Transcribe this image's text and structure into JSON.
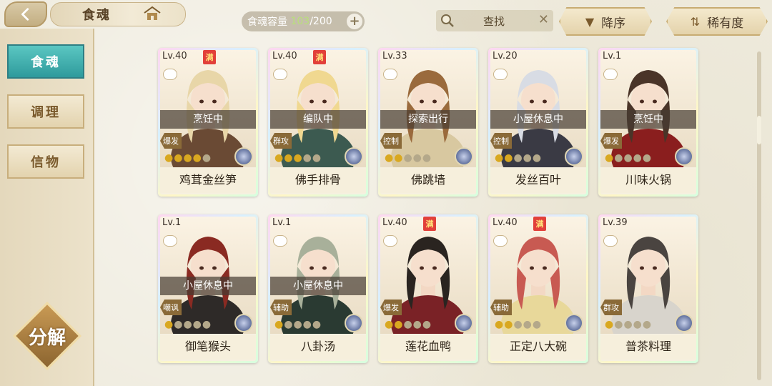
{
  "header": {
    "title": "食魂",
    "capacity_label": "食魂容量",
    "capacity_current": "103",
    "capacity_sep": "/",
    "capacity_max": "200",
    "search_label": "查找",
    "sort_desc": "降序",
    "sort_rarity": "稀有度"
  },
  "sidebar": {
    "tabs": [
      {
        "label": "食魂"
      },
      {
        "label": "调理"
      },
      {
        "label": "信物"
      }
    ],
    "decompose": "分解"
  },
  "cards": [
    {
      "level": "Lv.40",
      "full": "满",
      "status": "烹饪中",
      "role": "爆发",
      "stars_filled": 4,
      "name": "鸡茸金丝笋",
      "hair": "#e8d6a8",
      "outfit": "#6a4a34"
    },
    {
      "level": "Lv.40",
      "full": "满",
      "status": "编队中",
      "role": "群攻",
      "stars_filled": 3,
      "name": "佛手排骨",
      "hair": "#f0d890",
      "outfit": "#3c5a50"
    },
    {
      "level": "Lv.33",
      "full": "",
      "status": "探索出行",
      "role": "控制",
      "stars_filled": 2,
      "name": "佛跳墙",
      "hair": "#9a6a3c",
      "outfit": "#d8c8a0"
    },
    {
      "level": "Lv.20",
      "full": "",
      "status": "小屋休息中",
      "role": "控制",
      "stars_filled": 2,
      "name": "发丝百叶",
      "hair": "#d8dce4",
      "outfit": "#3a3a44"
    },
    {
      "level": "Lv.1",
      "full": "",
      "status": "烹饪中",
      "role": "爆发",
      "stars_filled": 1,
      "name": "川味火锅",
      "hair": "#4a3428",
      "outfit": "#8a1e1e"
    },
    {
      "level": "Lv.1",
      "full": "",
      "status": "小屋休息中",
      "role": "嘲讽",
      "stars_filled": 1,
      "name": "御笔猴头",
      "hair": "#8a2a22",
      "outfit": "#2e2a28"
    },
    {
      "level": "Lv.1",
      "full": "",
      "status": "小屋休息中",
      "role": "辅助",
      "stars_filled": 1,
      "name": "八卦汤",
      "hair": "#a8b09a",
      "outfit": "#2a3a32"
    },
    {
      "level": "Lv.40",
      "full": "满",
      "status": "",
      "role": "爆发",
      "stars_filled": 2,
      "name": "莲花血鸭",
      "hair": "#2a2420",
      "outfit": "#7a2226"
    },
    {
      "level": "Lv.40",
      "full": "满",
      "status": "",
      "role": "辅助",
      "stars_filled": 2,
      "name": "正定八大碗",
      "hair": "#c85a52",
      "outfit": "#e8d89a"
    },
    {
      "level": "Lv.39",
      "full": "",
      "status": "",
      "role": "群攻",
      "stars_filled": 1,
      "name": "普茶料理",
      "hair": "#4a4440",
      "outfit": "#d8d4cc"
    }
  ]
}
